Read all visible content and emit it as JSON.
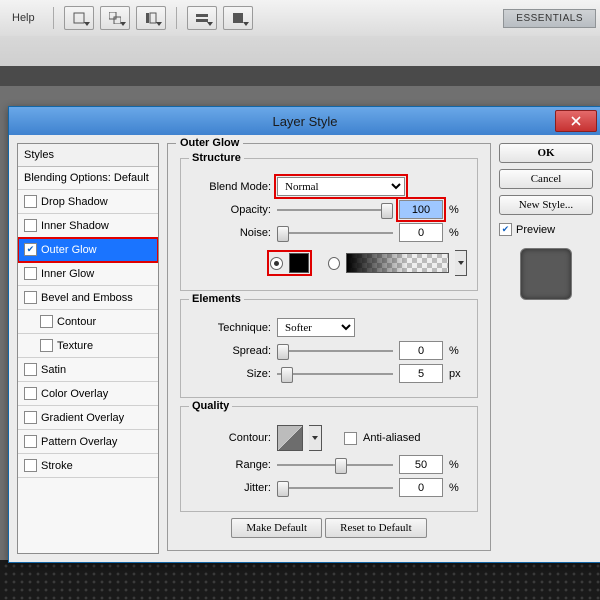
{
  "appbar": {
    "menu": "Help",
    "essentials": "ESSENTIALS"
  },
  "dialog": {
    "title": "Layer Style",
    "styles_header": "Styles",
    "blending": "Blending Options: Default",
    "items": [
      {
        "label": "Drop Shadow",
        "checked": false
      },
      {
        "label": "Inner Shadow",
        "checked": false
      },
      {
        "label": "Outer Glow",
        "checked": true,
        "selected": true
      },
      {
        "label": "Inner Glow",
        "checked": false
      },
      {
        "label": "Bevel and Emboss",
        "checked": false
      },
      {
        "label": "Contour",
        "checked": false,
        "sub": true
      },
      {
        "label": "Texture",
        "checked": false,
        "sub": true
      },
      {
        "label": "Satin",
        "checked": false
      },
      {
        "label": "Color Overlay",
        "checked": false
      },
      {
        "label": "Gradient Overlay",
        "checked": false
      },
      {
        "label": "Pattern Overlay",
        "checked": false
      },
      {
        "label": "Stroke",
        "checked": false
      }
    ],
    "group_title": "Outer Glow",
    "structure": {
      "legend": "Structure",
      "blend_mode_label": "Blend Mode:",
      "blend_mode_value": "Normal",
      "opacity_label": "Opacity:",
      "opacity_value": "100",
      "noise_label": "Noise:",
      "noise_value": "0",
      "pct": "%",
      "color": "#000000"
    },
    "elements": {
      "legend": "Elements",
      "technique_label": "Technique:",
      "technique_value": "Softer",
      "spread_label": "Spread:",
      "spread_value": "0",
      "size_label": "Size:",
      "size_value": "5",
      "pct": "%",
      "px": "px"
    },
    "quality": {
      "legend": "Quality",
      "contour_label": "Contour:",
      "anti_label": "Anti-aliased",
      "range_label": "Range:",
      "range_value": "50",
      "jitter_label": "Jitter:",
      "jitter_value": "0",
      "pct": "%"
    },
    "make_default": "Make Default",
    "reset_default": "Reset to Default",
    "buttons": {
      "ok": "OK",
      "cancel": "Cancel",
      "new_style": "New Style...",
      "preview": "Preview"
    }
  }
}
